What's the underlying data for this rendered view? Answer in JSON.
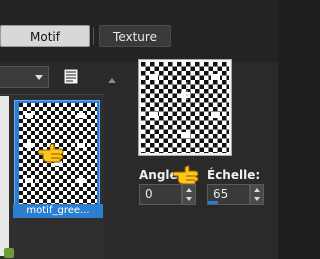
{
  "tabs": [
    {
      "label": "Motif",
      "active": true
    },
    {
      "label": "Texture",
      "active": false
    }
  ],
  "pattern_list": {
    "selected_item_label": "motif_gree..."
  },
  "preview": {
    "angle_label": "Angle:",
    "angle_value": "0",
    "scale_label": "Échelle:",
    "scale_value": "65"
  },
  "colors": {
    "accent": "#2c7fd0",
    "background": "#2a2a2a"
  },
  "icons": [
    "document-icon",
    "pointing-hand-icon",
    "dropdown-arrow-icon",
    "spinner-arrows-icon"
  ]
}
